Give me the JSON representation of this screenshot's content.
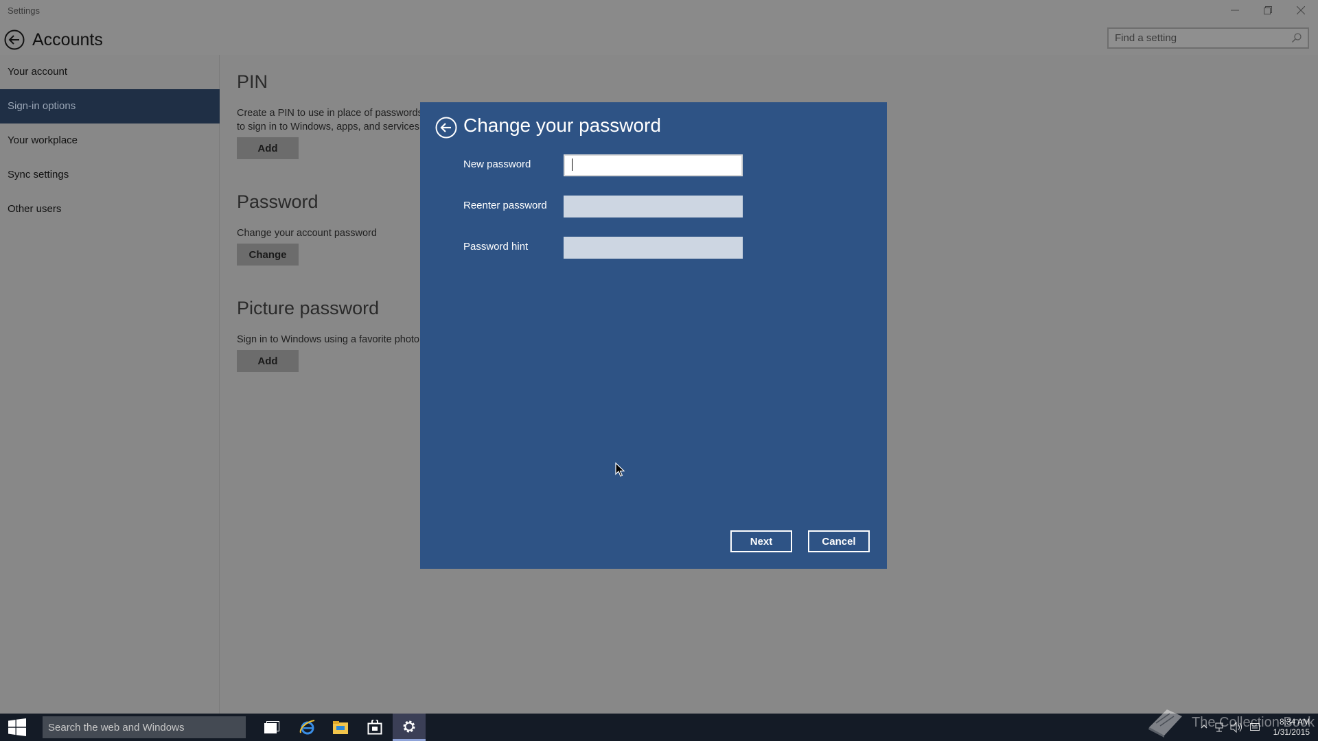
{
  "window": {
    "app_name": "Settings"
  },
  "header": {
    "title": "Accounts",
    "search_placeholder": "Find a setting"
  },
  "sidebar": {
    "items": [
      {
        "label": "Your account"
      },
      {
        "label": "Sign-in options",
        "active": true
      },
      {
        "label": "Your workplace"
      },
      {
        "label": "Sync settings"
      },
      {
        "label": "Other users"
      }
    ]
  },
  "sections": {
    "pin": {
      "title": "PIN",
      "desc_line1": "Create a PIN to use in place of passwords.",
      "desc_line2": "to sign in to Windows, apps, and services.",
      "button": "Add"
    },
    "password": {
      "title": "Password",
      "desc": "Change your account password",
      "button": "Change"
    },
    "picture": {
      "title": "Picture password",
      "desc": "Sign in to Windows using a favorite photo",
      "button": "Add"
    }
  },
  "dialog": {
    "title": "Change your password",
    "fields": [
      {
        "label": "New password",
        "value": ""
      },
      {
        "label": "Reenter password",
        "value": ""
      },
      {
        "label": "Password hint",
        "value": ""
      }
    ],
    "next_label": "Next",
    "cancel_label": "Cancel"
  },
  "taskbar": {
    "search_placeholder": "Search the web and Windows",
    "time": "8:34 AM",
    "date": "1/31/2015",
    "watermark": "The Collection Book"
  },
  "colors": {
    "dialog_bg": "#2e5385",
    "sidebar_active": "#1f2f45",
    "taskbar": "#141b26"
  }
}
